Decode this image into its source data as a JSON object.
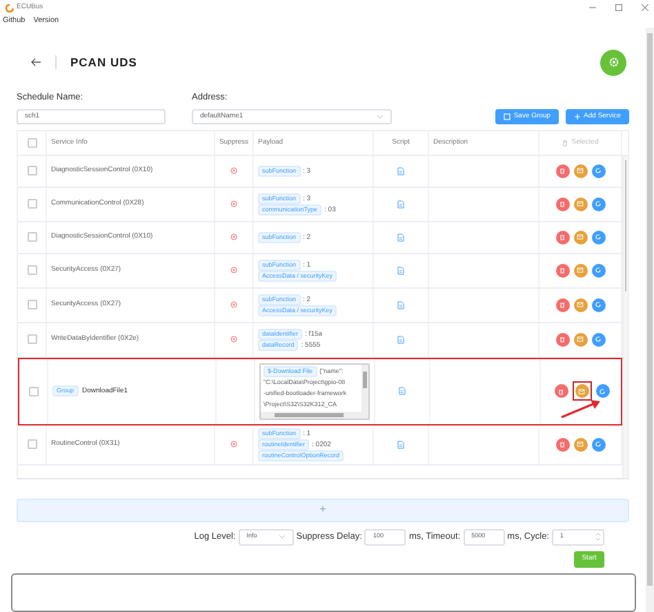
{
  "window": {
    "title": "ECUBus"
  },
  "menu": [
    {
      "label": "Github"
    },
    {
      "label": "Version"
    }
  ],
  "header": {
    "title": "PCAN UDS"
  },
  "form": {
    "schedule_label": "Schedule Name:",
    "schedule_value": "sch1",
    "address_label": "Address:",
    "address_value": "defaultName1",
    "buttons": [
      {
        "label": "Save Group",
        "kind": "save"
      },
      {
        "label": "Add Service",
        "kind": "add"
      }
    ]
  },
  "table": {
    "select_all_checked": false,
    "columns": [
      "Service Info",
      "Suppress",
      "Payload",
      "Script",
      "Description",
      "Selected"
    ],
    "rows": [
      {
        "kind": "service",
        "checked": false,
        "name": "DiagnosticSessionControl (0X10)",
        "payload": [
          {
            "key": "subFunction",
            "value": ": 3"
          }
        ]
      },
      {
        "kind": "service",
        "checked": false,
        "name": "CommunicationControl (0X28)",
        "payload": [
          {
            "key": "subFunction",
            "value": ": 3"
          },
          {
            "key": "communicationType",
            "value": ": 03"
          }
        ]
      },
      {
        "kind": "service",
        "checked": false,
        "name": "DiagnosticSessionControl (0X10)",
        "payload": [
          {
            "key": "subFunction",
            "value": ": 2"
          }
        ]
      },
      {
        "kind": "service",
        "checked": false,
        "name": "SecurityAccess (0X27)",
        "payload": [
          {
            "key": "subFunction",
            "value": ": 1"
          },
          {
            "key": "AccessData / securityKey"
          }
        ]
      },
      {
        "kind": "service",
        "checked": false,
        "name": "SecurityAccess (0X27)",
        "payload": [
          {
            "key": "subFunction",
            "value": ": 2"
          },
          {
            "key": "AccessData / securityKey"
          }
        ]
      },
      {
        "kind": "service",
        "checked": false,
        "name": "WriteDataByIdentifier (0X2e)",
        "payload": [
          {
            "key": "dataIdentifier",
            "value": ": f15a"
          },
          {
            "key": "dataRecord",
            "value": ": 5555"
          }
        ]
      },
      {
        "kind": "group",
        "checked": false,
        "highlighted": true,
        "tag": "Group",
        "name": "DownloadFile1",
        "payload_tag": "$-Download File",
        "payload_lines": [
          "{\"name\":",
          "\"C:\\LocalData\\Project\\gpio-08",
          "-unified-bootloader-framework",
          "\\Project\\S32\\S32K312_CA"
        ]
      },
      {
        "kind": "service",
        "checked": false,
        "name": "RoutineControl (0X31)",
        "payload": [
          {
            "key": "subFunction",
            "value": ": 1"
          },
          {
            "key": "routineIdentifier",
            "value": ": 0202"
          },
          {
            "key": "routineControlOptionRecord"
          }
        ]
      }
    ]
  },
  "add_bar": {
    "label": "+"
  },
  "settings": {
    "log_level_label": "Log Level:",
    "log_level": "Info",
    "suppress_label": "Suppress Delay:",
    "suppress_value": "100",
    "timeout_label": "ms, Timeout:",
    "timeout_value": "5000",
    "cycle_label": "ms, Cycle:",
    "cycle_value": "1"
  },
  "start_button": {
    "label": "Start"
  }
}
